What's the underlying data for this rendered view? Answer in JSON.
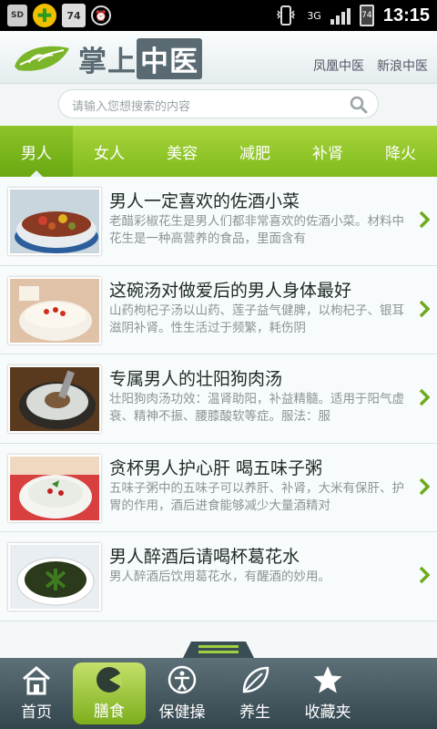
{
  "status": {
    "time": "13:15",
    "notif_badge": "74",
    "battery": "74",
    "network": "3G",
    "icons": [
      "sd-card-icon",
      "plus-app-icon",
      "badge-74-icon",
      "alarm-clock-icon",
      "vibrate-icon",
      "signal-3g-icon",
      "signal-bars-icon",
      "battery-icon"
    ]
  },
  "header": {
    "logo_text_1": "掌上",
    "logo_text_2": "中医",
    "links": [
      "凤凰中医",
      "新浪中医"
    ]
  },
  "search": {
    "placeholder": "请输入您想搜索的内容"
  },
  "tabs": [
    {
      "label": "男人",
      "active": true
    },
    {
      "label": "女人",
      "active": false
    },
    {
      "label": "美容",
      "active": false
    },
    {
      "label": "减肥",
      "active": false
    },
    {
      "label": "补肾",
      "active": false
    },
    {
      "label": "降火",
      "active": false
    }
  ],
  "items": [
    {
      "title": "男人一定喜欢的佐酒小菜",
      "desc": "老醋彩椒花生是男人们都非常喜欢的佐酒小菜。材料中花生是一种高营养的食品，里面含有"
    },
    {
      "title": "这碗汤对做爱后的男人身体最好",
      "desc": "山药枸杞子汤以山药、莲子益气健脾，以枸杞子、银耳滋阴补肾。性生活过于频繁，耗伤阴"
    },
    {
      "title": "专属男人的壮阳狗肉汤",
      "desc": "壮阳狗肉汤功效：温肾助阳，补益精髓。适用于阳气虚衰、精神不振、腰膝酸软等症。服法：服"
    },
    {
      "title": "贪杯男人护心肝 喝五味子粥",
      "desc": "五味子粥中的五味子可以养肝、补肾，大米有保肝、护胃的作用，酒后进食能够减少大量酒精对"
    },
    {
      "title": "男人醉酒后请喝杯葛花水",
      "desc": "男人醉酒后饮用葛花水，有醒酒的妙用。"
    }
  ],
  "bottom_nav": [
    {
      "label": "首页",
      "icon": "home-icon",
      "active": false
    },
    {
      "label": "膳食",
      "icon": "bowl-icon",
      "active": true
    },
    {
      "label": "保健操",
      "icon": "exercise-icon",
      "active": false
    },
    {
      "label": "养生",
      "icon": "leaf-icon",
      "active": false
    },
    {
      "label": "收藏夹",
      "icon": "star-icon",
      "active": false
    }
  ],
  "colors": {
    "tab_green": "#8cc428",
    "nav_dark": "#3e5058",
    "accent_green": "#7fbb1c"
  }
}
